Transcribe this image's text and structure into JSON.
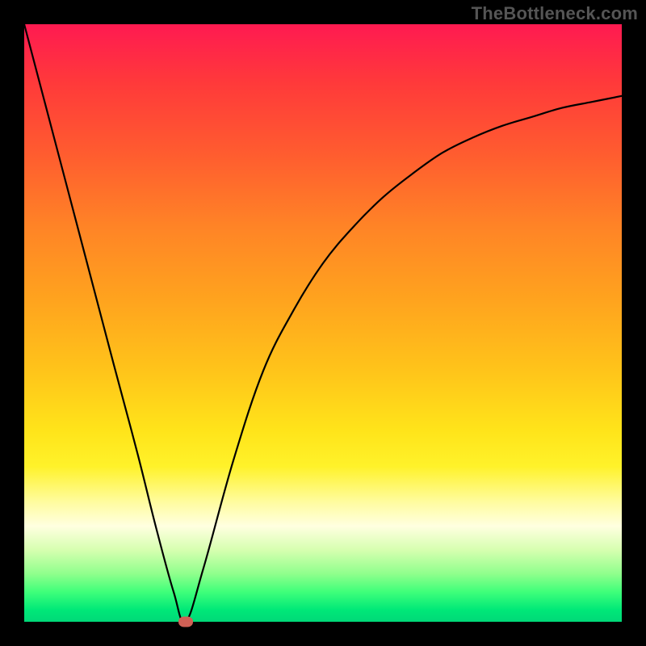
{
  "watermark": "TheBottleneck.com",
  "chart_data": {
    "type": "line",
    "title": "",
    "xlabel": "",
    "ylabel": "",
    "xlim": [
      0,
      100
    ],
    "ylim": [
      0,
      100
    ],
    "grid": false,
    "legend": false,
    "series": [
      {
        "name": "curve",
        "x": [
          0,
          5,
          10,
          15,
          19,
          22,
          25,
          27,
          30,
          35,
          40,
          45,
          50,
          55,
          60,
          65,
          70,
          75,
          80,
          85,
          90,
          95,
          100
        ],
        "values": [
          100,
          81,
          62,
          43,
          28,
          16,
          5,
          0,
          9,
          27,
          42,
          52,
          60,
          66,
          71,
          75,
          78.5,
          81,
          83,
          84.5,
          86,
          87,
          88
        ]
      }
    ],
    "marker": {
      "x": 27,
      "y": 0,
      "color": "#d06055"
    },
    "background_gradient": {
      "top": "#ff1a51",
      "bottom": "#00d878"
    }
  }
}
